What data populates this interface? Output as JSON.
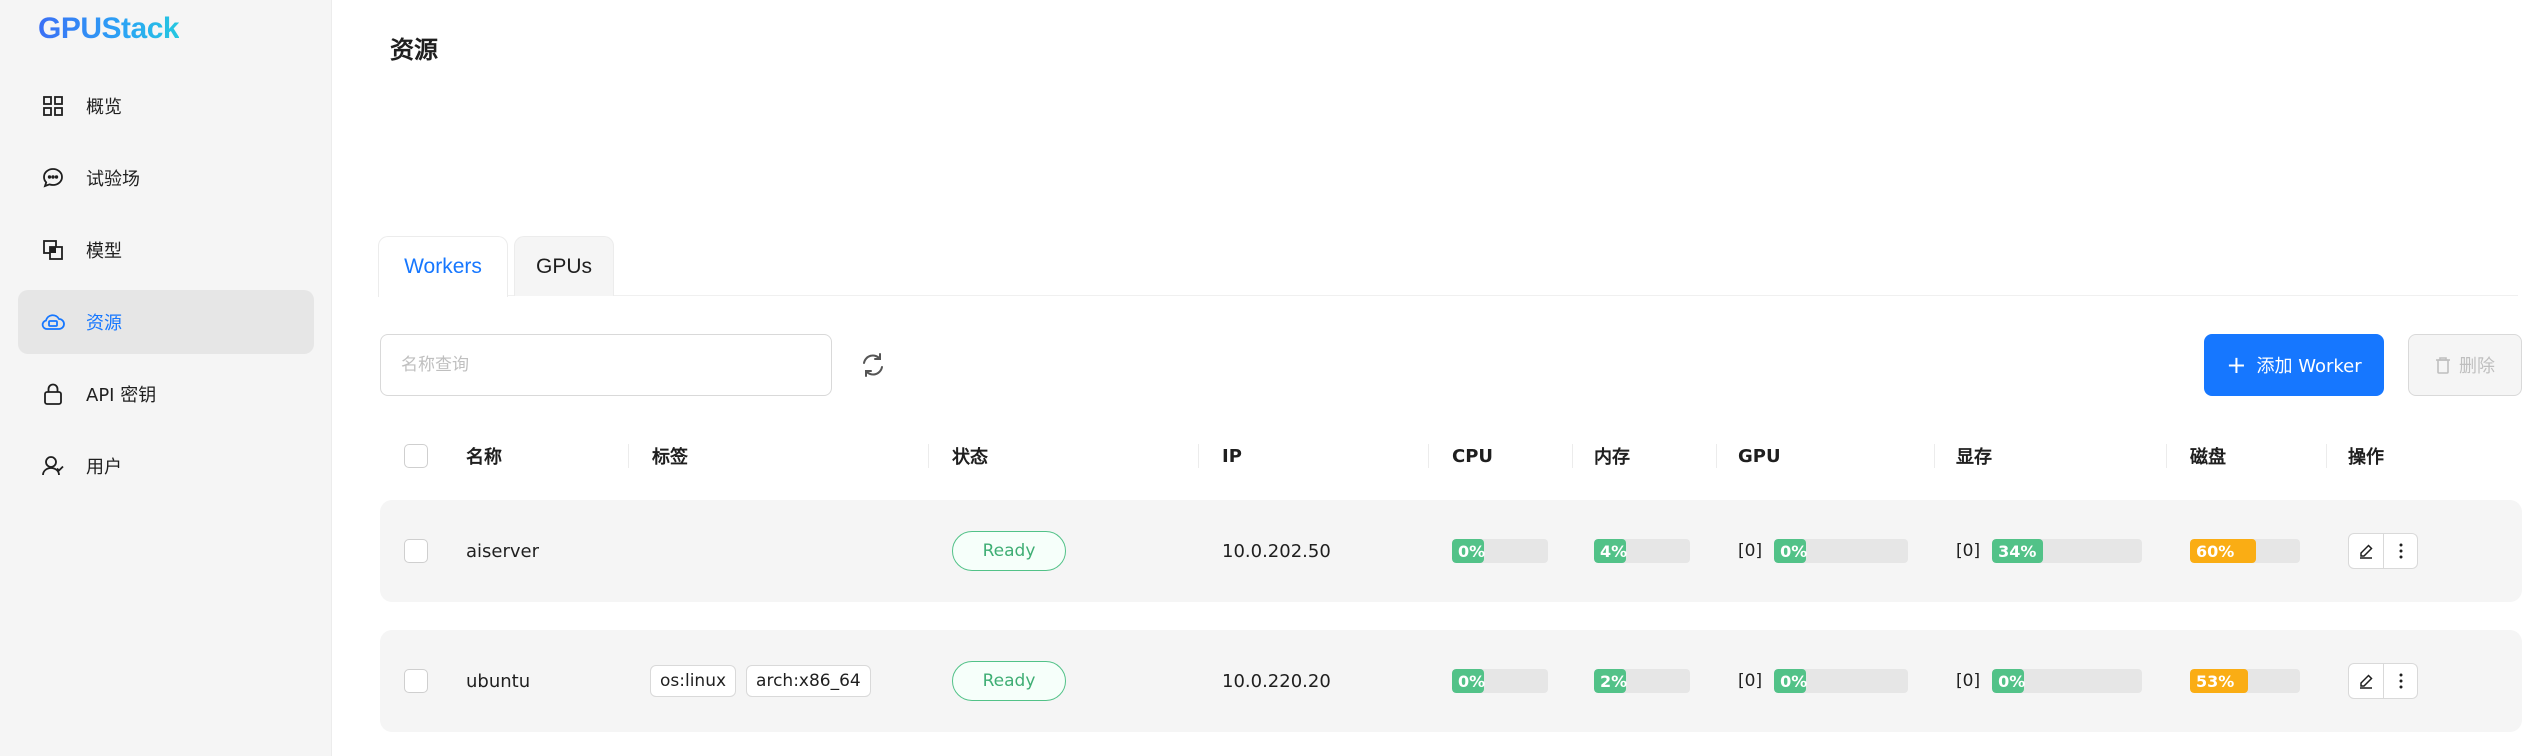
{
  "app": {
    "logo": "GPUStack"
  },
  "sidebar": {
    "items": [
      {
        "label": "概览",
        "icon": "dashboard-icon"
      },
      {
        "label": "试验场",
        "icon": "chat-icon"
      },
      {
        "label": "模型",
        "icon": "model-icon"
      },
      {
        "label": "资源",
        "icon": "cloud-icon",
        "active": true
      },
      {
        "label": "API 密钥",
        "icon": "lock-icon"
      },
      {
        "label": "用户",
        "icon": "user-icon"
      }
    ]
  },
  "page": {
    "title": "资源"
  },
  "tabs": [
    {
      "label": "Workers",
      "active": true
    },
    {
      "label": "GPUs",
      "active": false
    }
  ],
  "toolbar": {
    "search_placeholder": "名称查询",
    "add_label": "添加 Worker",
    "delete_label": "删除"
  },
  "table": {
    "headers": {
      "name": "名称",
      "labels": "标签",
      "status": "状态",
      "ip": "IP",
      "cpu": "CPU",
      "memory": "内存",
      "gpu": "GPU",
      "vram": "显存",
      "disk": "磁盘",
      "actions": "操作"
    },
    "rows": [
      {
        "name": "aiserver",
        "labels": [],
        "status": "Ready",
        "ip": "10.0.202.50",
        "cpu": {
          "text": "0%",
          "pct": 0
        },
        "memory": {
          "text": "4%",
          "pct": 4
        },
        "gpu": {
          "index": "[0]",
          "text": "0%",
          "pct": 0
        },
        "vram": {
          "index": "[0]",
          "text": "34%",
          "pct": 34
        },
        "disk": {
          "text": "60%",
          "pct": 60
        }
      },
      {
        "name": "ubuntu",
        "labels": [
          "os:linux",
          "arch:x86_64"
        ],
        "status": "Ready",
        "ip": "10.0.220.20",
        "cpu": {
          "text": "0%",
          "pct": 0
        },
        "memory": {
          "text": "2%",
          "pct": 2
        },
        "gpu": {
          "index": "[0]",
          "text": "0%",
          "pct": 0
        },
        "vram": {
          "index": "[0]",
          "text": "0%",
          "pct": 0
        },
        "disk": {
          "text": "53%",
          "pct": 53
        }
      }
    ]
  },
  "colors": {
    "accent": "#1677ff",
    "bar_green": "#52c288",
    "bar_orange": "#faad14",
    "status_ready": "#52c288"
  }
}
